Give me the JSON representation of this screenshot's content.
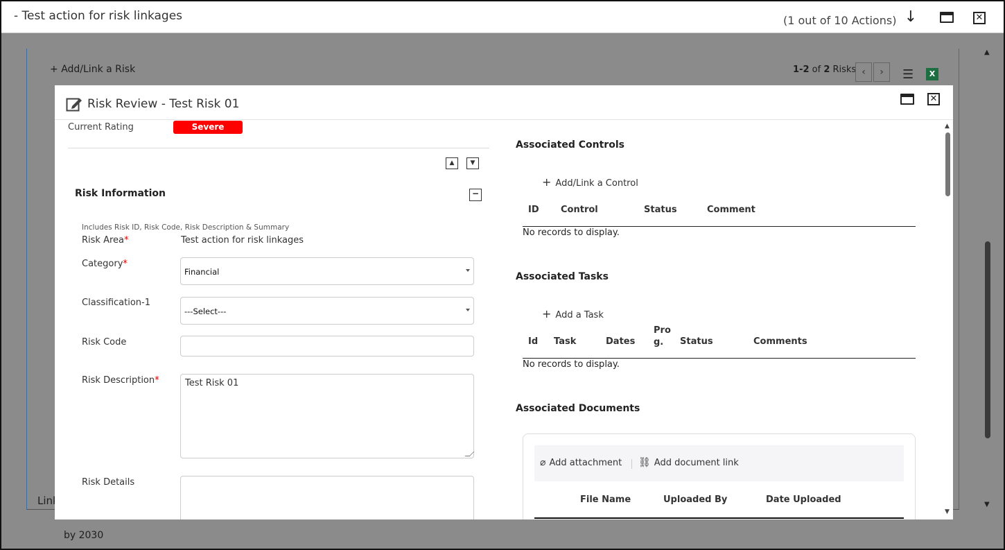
{
  "window": {
    "title": "- Test action for risk linkages",
    "count": "(1 out of 10 Actions)"
  },
  "background": {
    "add_link_risk": "Add/Link a Risk",
    "pager_range": "1-2",
    "pager_of": "of",
    "pager_total": "2",
    "pager_unit": "Risks",
    "excel_letter": "X",
    "link_text": "Link",
    "by_text": "by 2030"
  },
  "modal": {
    "title": "Risk Review - Test Risk 01",
    "current_rating_label": "Current Rating",
    "current_rating_value": "Severe",
    "rating_color": "#ff0000",
    "section_title": "Risk Information",
    "includes_note": "Includes Risk ID, Risk Code, Risk Description & Summary",
    "fields": {
      "risk_area_label": "Risk Area",
      "risk_area_value": "Test action for risk linkages",
      "category_label": "Category",
      "category_value": "Financial",
      "classification_label": "Classification-1",
      "classification_value": "---Select---",
      "risk_code_label": "Risk Code",
      "risk_code_value": "",
      "risk_description_label": "Risk Description",
      "risk_description_value": "Test Risk 01",
      "risk_details_label": "Risk Details"
    },
    "controls": {
      "title": "Associated Controls",
      "add_label": "Add/Link a Control",
      "columns": [
        "ID",
        "Control",
        "Status",
        "Comment"
      ],
      "empty": "No records to display."
    },
    "tasks": {
      "title": "Associated Tasks",
      "add_label": "Add a Task",
      "columns": [
        "Id",
        "Task",
        "Dates",
        "Pro",
        "g.",
        "Status",
        "Comments"
      ],
      "empty": "No records to display."
    },
    "documents": {
      "title": "Associated Documents",
      "add_attachment": "Add attachment",
      "add_link": "Add document link",
      "columns": [
        "File Name",
        "Uploaded By",
        "Date Uploaded"
      ]
    }
  }
}
